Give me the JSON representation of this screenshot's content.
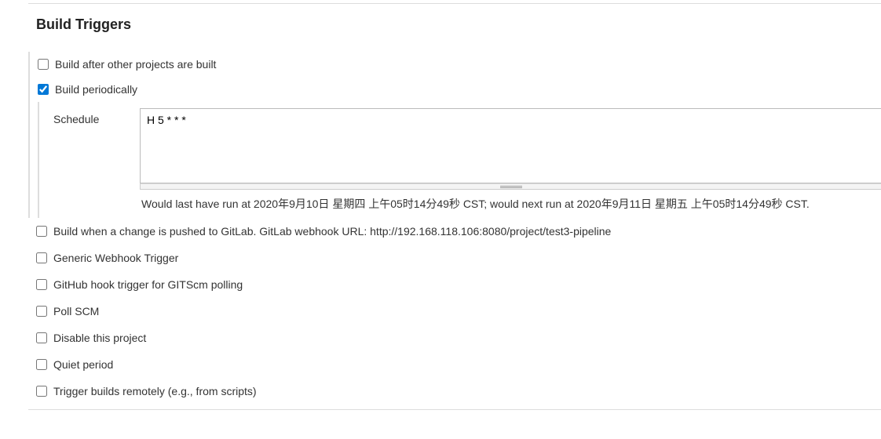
{
  "section": {
    "title": "Build Triggers"
  },
  "triggers": {
    "build_after": {
      "label": "Build after other projects are built",
      "checked": false
    },
    "periodically": {
      "label": "Build periodically",
      "checked": true,
      "schedule_label": "Schedule",
      "schedule_value": "H 5 * * *",
      "schedule_hint": "Would last have run at 2020年9月10日 星期四 上午05时14分49秒 CST; would next run at 2020年9月11日 星期五 上午05时14分49秒 CST."
    },
    "gitlab_push": {
      "label": "Build when a change is pushed to GitLab. GitLab webhook URL: http://192.168.118.106:8080/project/test3-pipeline",
      "checked": false
    },
    "generic_webhook": {
      "label": "Generic Webhook Trigger",
      "checked": false
    },
    "github_hook": {
      "label": "GitHub hook trigger for GITScm polling",
      "checked": false
    },
    "poll_scm": {
      "label": "Poll SCM",
      "checked": false
    },
    "disable_project": {
      "label": "Disable this project",
      "checked": false
    },
    "quiet_period": {
      "label": "Quiet period",
      "checked": false
    },
    "remote_trigger": {
      "label": "Trigger builds remotely (e.g., from scripts)",
      "checked": false
    }
  }
}
